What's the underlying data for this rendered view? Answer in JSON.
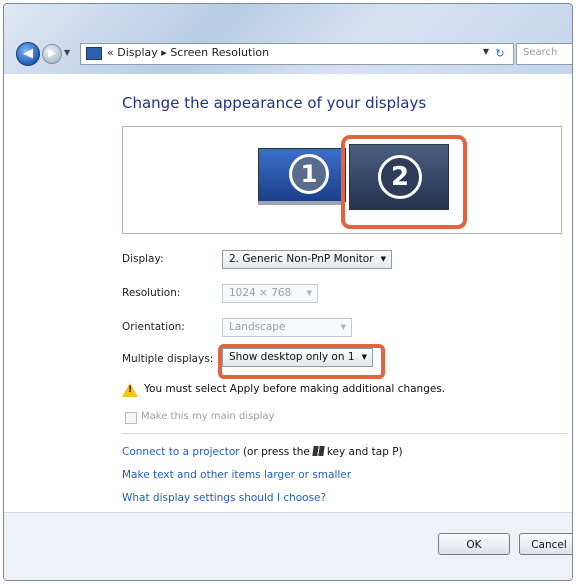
{
  "window": {
    "breadcrumb_sep": "«",
    "breadcrumb": [
      "Display",
      "Screen Resolution"
    ],
    "breadcrumb_arrow": "▸",
    "search_placeholder": "Search"
  },
  "page": {
    "heading": "Change the appearance of your displays",
    "monitors": [
      {
        "number": "1"
      },
      {
        "number": "2",
        "selected": true
      }
    ]
  },
  "form": {
    "display": {
      "label": "Display:",
      "value": "2. Generic Non-PnP Monitor"
    },
    "resolution": {
      "label": "Resolution:",
      "value": "1024 × 768",
      "disabled": true
    },
    "orientation": {
      "label": "Orientation:",
      "value": "Landscape",
      "disabled": true
    },
    "multiple": {
      "label": "Multiple displays:",
      "value": "Show desktop only on 1"
    }
  },
  "warning": {
    "text": "You must select Apply before making additional changes."
  },
  "checkbox": {
    "label": "Make this my main display",
    "disabled": true,
    "checked": false
  },
  "links": {
    "projector_link": "Connect to a projector",
    "projector_pre": "(or press the",
    "projector_post": "key and tap P)",
    "text_size": "Make text and other items larger or smaller",
    "help": "What display settings should I choose?"
  },
  "buttons": {
    "ok": "OK",
    "cancel": "Cancel"
  },
  "colors": {
    "highlight": "#e2633f",
    "link": "#1f5fbf",
    "heading": "#1e3287"
  }
}
